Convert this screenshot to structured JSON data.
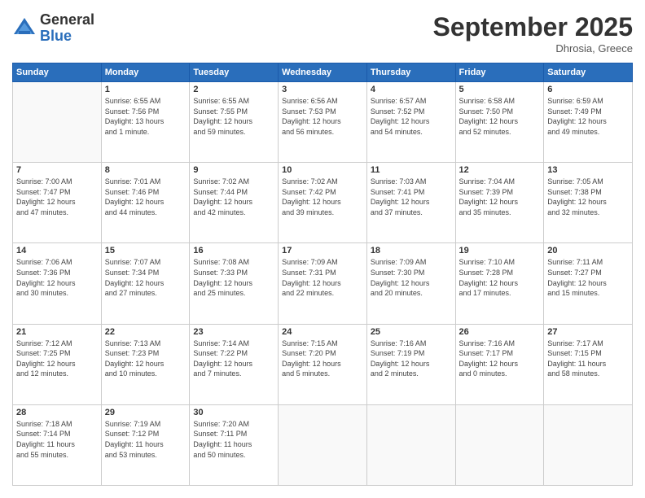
{
  "logo": {
    "general": "General",
    "blue": "Blue"
  },
  "title": "September 2025",
  "location": "Dhrosia, Greece",
  "days_header": [
    "Sunday",
    "Monday",
    "Tuesday",
    "Wednesday",
    "Thursday",
    "Friday",
    "Saturday"
  ],
  "weeks": [
    [
      {
        "num": "",
        "info": ""
      },
      {
        "num": "1",
        "info": "Sunrise: 6:55 AM\nSunset: 7:56 PM\nDaylight: 13 hours\nand 1 minute."
      },
      {
        "num": "2",
        "info": "Sunrise: 6:55 AM\nSunset: 7:55 PM\nDaylight: 12 hours\nand 59 minutes."
      },
      {
        "num": "3",
        "info": "Sunrise: 6:56 AM\nSunset: 7:53 PM\nDaylight: 12 hours\nand 56 minutes."
      },
      {
        "num": "4",
        "info": "Sunrise: 6:57 AM\nSunset: 7:52 PM\nDaylight: 12 hours\nand 54 minutes."
      },
      {
        "num": "5",
        "info": "Sunrise: 6:58 AM\nSunset: 7:50 PM\nDaylight: 12 hours\nand 52 minutes."
      },
      {
        "num": "6",
        "info": "Sunrise: 6:59 AM\nSunset: 7:49 PM\nDaylight: 12 hours\nand 49 minutes."
      }
    ],
    [
      {
        "num": "7",
        "info": "Sunrise: 7:00 AM\nSunset: 7:47 PM\nDaylight: 12 hours\nand 47 minutes."
      },
      {
        "num": "8",
        "info": "Sunrise: 7:01 AM\nSunset: 7:46 PM\nDaylight: 12 hours\nand 44 minutes."
      },
      {
        "num": "9",
        "info": "Sunrise: 7:02 AM\nSunset: 7:44 PM\nDaylight: 12 hours\nand 42 minutes."
      },
      {
        "num": "10",
        "info": "Sunrise: 7:02 AM\nSunset: 7:42 PM\nDaylight: 12 hours\nand 39 minutes."
      },
      {
        "num": "11",
        "info": "Sunrise: 7:03 AM\nSunset: 7:41 PM\nDaylight: 12 hours\nand 37 minutes."
      },
      {
        "num": "12",
        "info": "Sunrise: 7:04 AM\nSunset: 7:39 PM\nDaylight: 12 hours\nand 35 minutes."
      },
      {
        "num": "13",
        "info": "Sunrise: 7:05 AM\nSunset: 7:38 PM\nDaylight: 12 hours\nand 32 minutes."
      }
    ],
    [
      {
        "num": "14",
        "info": "Sunrise: 7:06 AM\nSunset: 7:36 PM\nDaylight: 12 hours\nand 30 minutes."
      },
      {
        "num": "15",
        "info": "Sunrise: 7:07 AM\nSunset: 7:34 PM\nDaylight: 12 hours\nand 27 minutes."
      },
      {
        "num": "16",
        "info": "Sunrise: 7:08 AM\nSunset: 7:33 PM\nDaylight: 12 hours\nand 25 minutes."
      },
      {
        "num": "17",
        "info": "Sunrise: 7:09 AM\nSunset: 7:31 PM\nDaylight: 12 hours\nand 22 minutes."
      },
      {
        "num": "18",
        "info": "Sunrise: 7:09 AM\nSunset: 7:30 PM\nDaylight: 12 hours\nand 20 minutes."
      },
      {
        "num": "19",
        "info": "Sunrise: 7:10 AM\nSunset: 7:28 PM\nDaylight: 12 hours\nand 17 minutes."
      },
      {
        "num": "20",
        "info": "Sunrise: 7:11 AM\nSunset: 7:27 PM\nDaylight: 12 hours\nand 15 minutes."
      }
    ],
    [
      {
        "num": "21",
        "info": "Sunrise: 7:12 AM\nSunset: 7:25 PM\nDaylight: 12 hours\nand 12 minutes."
      },
      {
        "num": "22",
        "info": "Sunrise: 7:13 AM\nSunset: 7:23 PM\nDaylight: 12 hours\nand 10 minutes."
      },
      {
        "num": "23",
        "info": "Sunrise: 7:14 AM\nSunset: 7:22 PM\nDaylight: 12 hours\nand 7 minutes."
      },
      {
        "num": "24",
        "info": "Sunrise: 7:15 AM\nSunset: 7:20 PM\nDaylight: 12 hours\nand 5 minutes."
      },
      {
        "num": "25",
        "info": "Sunrise: 7:16 AM\nSunset: 7:19 PM\nDaylight: 12 hours\nand 2 minutes."
      },
      {
        "num": "26",
        "info": "Sunrise: 7:16 AM\nSunset: 7:17 PM\nDaylight: 12 hours\nand 0 minutes."
      },
      {
        "num": "27",
        "info": "Sunrise: 7:17 AM\nSunset: 7:15 PM\nDaylight: 11 hours\nand 58 minutes."
      }
    ],
    [
      {
        "num": "28",
        "info": "Sunrise: 7:18 AM\nSunset: 7:14 PM\nDaylight: 11 hours\nand 55 minutes."
      },
      {
        "num": "29",
        "info": "Sunrise: 7:19 AM\nSunset: 7:12 PM\nDaylight: 11 hours\nand 53 minutes."
      },
      {
        "num": "30",
        "info": "Sunrise: 7:20 AM\nSunset: 7:11 PM\nDaylight: 11 hours\nand 50 minutes."
      },
      {
        "num": "",
        "info": ""
      },
      {
        "num": "",
        "info": ""
      },
      {
        "num": "",
        "info": ""
      },
      {
        "num": "",
        "info": ""
      }
    ]
  ]
}
